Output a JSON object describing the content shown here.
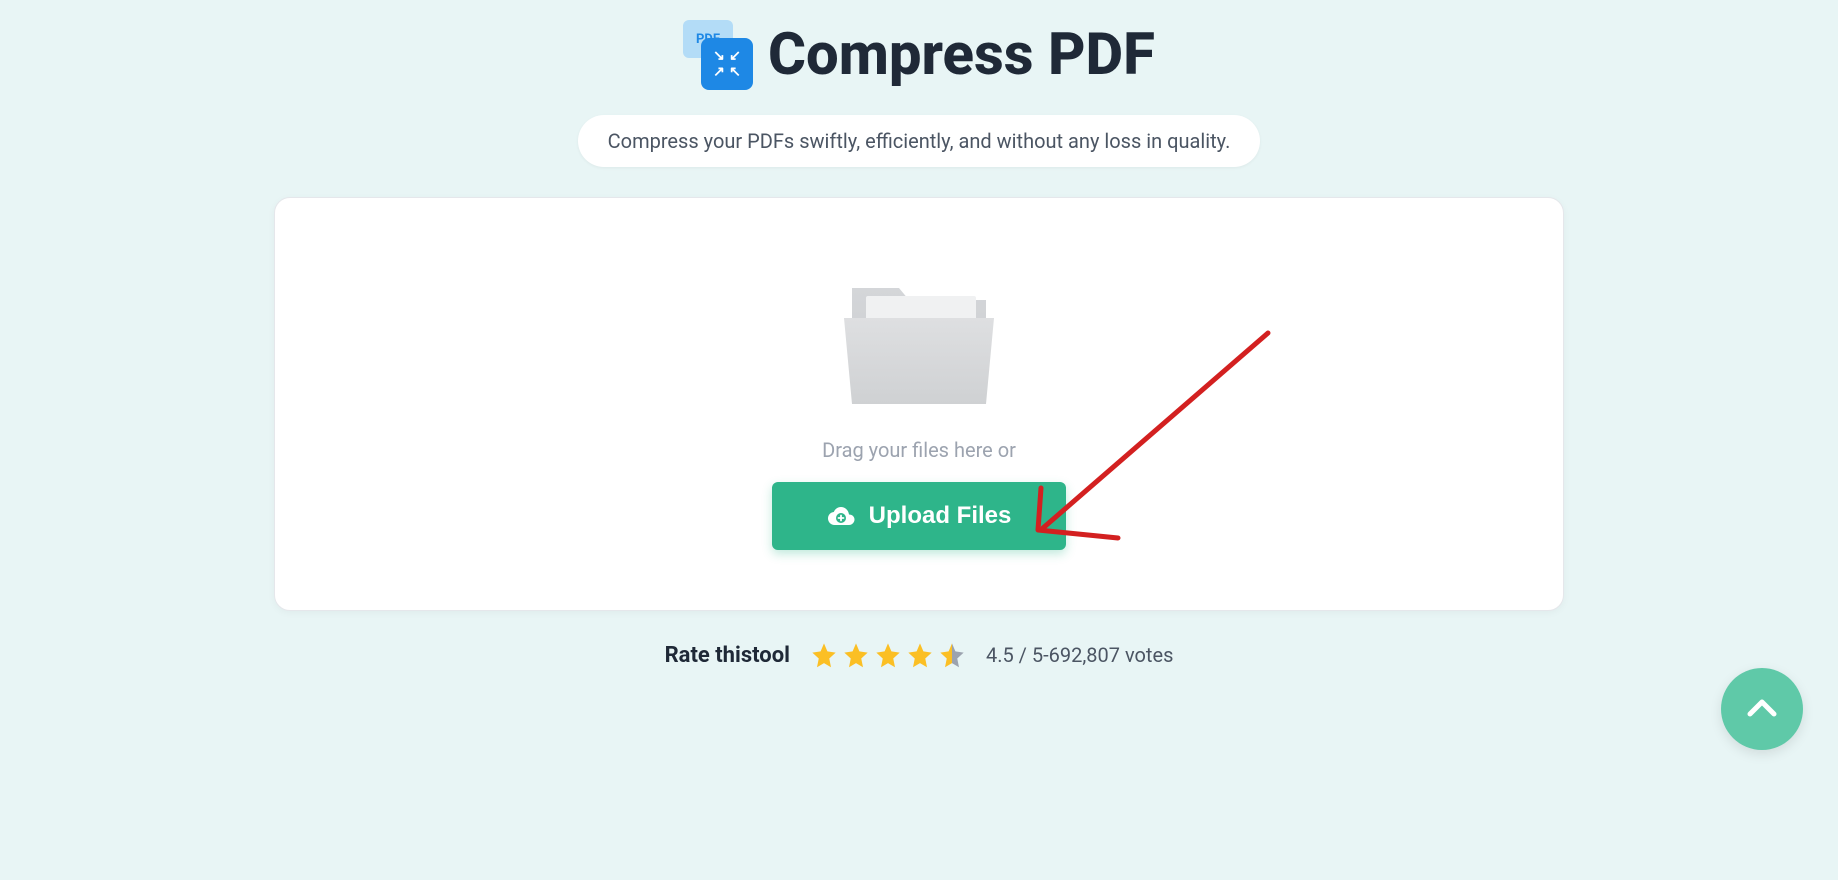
{
  "header": {
    "icon_badge_text": "PDF",
    "title": "Compress PDF",
    "subtitle": "Compress your PDFs swiftly, efficiently, and without any loss in quality."
  },
  "upload_area": {
    "drag_text": "Drag your files here or",
    "button_label": "Upload Files"
  },
  "rating": {
    "label": "Rate thistool",
    "score": "4.5",
    "max": "5",
    "votes": "692,807",
    "text": "4.5 / 5-692,807 votes",
    "stars_full": 4,
    "stars_half": 1
  }
}
